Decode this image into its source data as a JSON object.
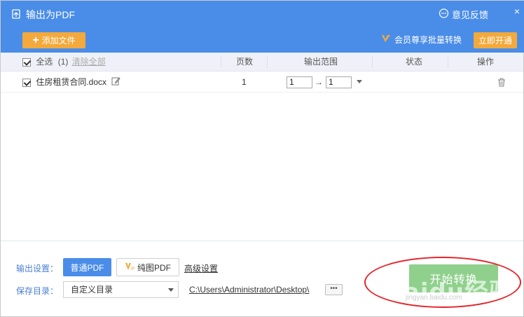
{
  "window": {
    "title": "输出为PDF",
    "feedback": "意见反馈",
    "close": "×"
  },
  "toolbar": {
    "add_file": "添加文件",
    "vip_text": "会员尊享批量转换",
    "open_vip": "立即开通"
  },
  "table": {
    "select_all": "全选",
    "count": "(1)",
    "clear_all": "清除全部",
    "headers": {
      "pages": "页数",
      "range": "输出范围",
      "status": "状态",
      "action": "操作"
    },
    "rows": [
      {
        "name": "住房租赁合同.docx",
        "pages": "1",
        "range_from": "1",
        "range_arrow": "→",
        "range_to": "1",
        "status": ""
      }
    ]
  },
  "settings": {
    "output_label": "输出设置：",
    "normal_pdf": "普通PDF",
    "pure_pdf": "纯图PDF",
    "advanced": "高级设置",
    "save_dir_label": "保存目录：",
    "save_dir_option": "自定义目录",
    "path": "C:\\Users\\Administrator\\Desktop\\",
    "browse": "•••",
    "start": "开始转换"
  },
  "watermark": {
    "main": "Baidu经验",
    "sub": "jingyan.baidu.com"
  },
  "colors": {
    "topbar": "#4a8de8",
    "accent_orange": "#f3a93b",
    "start_green": "#8fd18c",
    "annotation_red": "#e4242b"
  }
}
